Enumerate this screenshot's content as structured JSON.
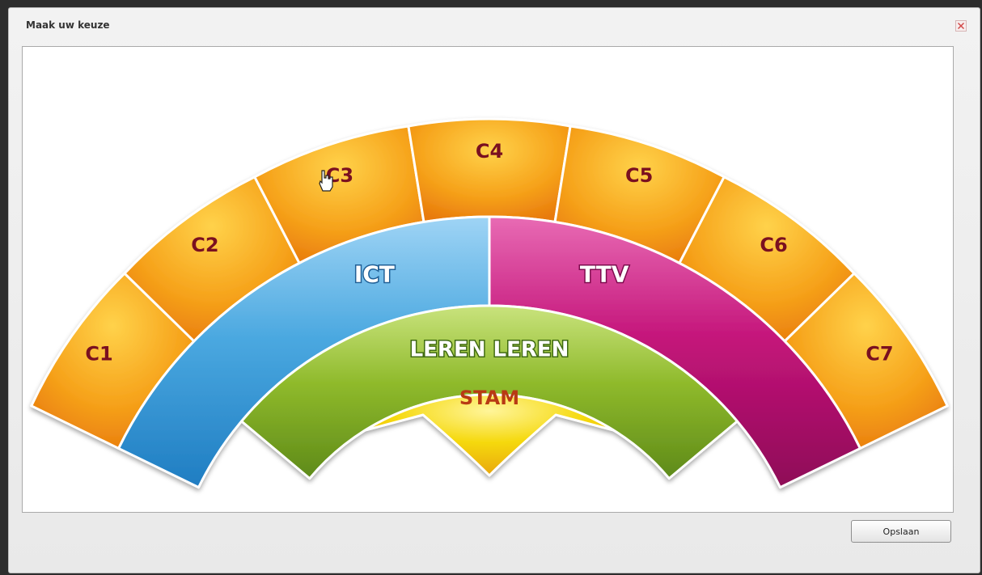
{
  "window": {
    "title": "Maak uw keuze",
    "close_icon": "close-icon"
  },
  "wheel": {
    "outer_ring": [
      "C1",
      "C2",
      "C3",
      "C4",
      "C5",
      "C6",
      "C7"
    ],
    "middle_left": "ICT",
    "middle_right": "TTV",
    "inner_band": "LEREN LEREN",
    "core": "STAM"
  },
  "colors": {
    "outer_ring": "#f39c12",
    "ict": "#4aa8e0",
    "ttv": "#c4147a",
    "leren_leren": "#8fba2b",
    "stam": "#f5d80a",
    "label_dark_red": "#7a1020",
    "label_stam": "#b83a14"
  },
  "footer": {
    "save_label": "Opslaan"
  }
}
